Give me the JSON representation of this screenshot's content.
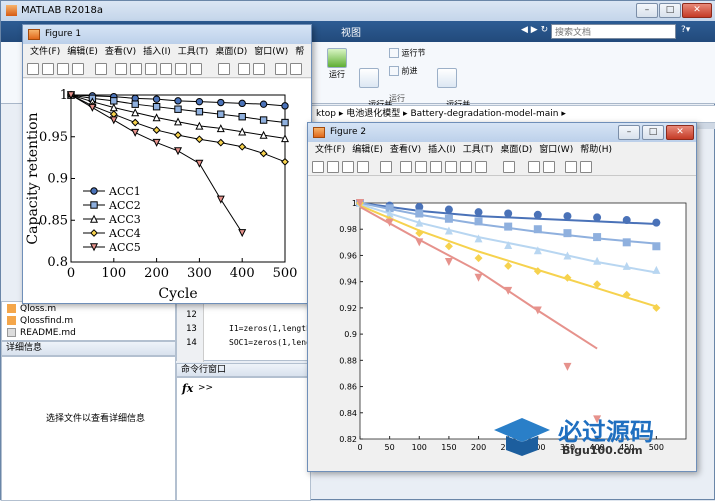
{
  "matlab": {
    "title": "MATLAB R2018a",
    "view_tab": "视图",
    "search_placeholder": "搜索文档",
    "run_section_title": "运行",
    "buttons": [
      {
        "label": "运行"
      },
      {
        "label": "运行并\n前进"
      },
      {
        "label": "运行节"
      },
      {
        "label": "前进"
      },
      {
        "label": "运行并\n计时"
      }
    ],
    "path": "ktop ▸ 电池退化模型 ▸ Battery-degradation-model-main ▸",
    "files": [
      "Qloss.m",
      "Qlossfind.m",
      "README.md"
    ],
    "details_header": "详细信息",
    "details_text": "选择文件以查看详细信息",
    "editor_lines": [
      {
        "num": "12",
        "code": ""
      },
      {
        "num": "13",
        "code": "I1=zeros(1,length"
      },
      {
        "num": "14",
        "code": "SOC1=zeros(1,leng"
      }
    ],
    "cmd_header": "命令行窗口",
    "cmd_prompt": ">>"
  },
  "figure1": {
    "title": "Figure 1",
    "menu": [
      "文件(F)",
      "编辑(E)",
      "查看(V)",
      "插入(I)",
      "工具(T)",
      "桌面(D)",
      "窗口(W)",
      "帮助(H)"
    ]
  },
  "figure2": {
    "title": "Figure 2",
    "menu": [
      "文件(F)",
      "编辑(E)",
      "查看(V)",
      "插入(I)",
      "工具(T)",
      "桌面(D)",
      "窗口(W)",
      "帮助(H)"
    ]
  },
  "watermark": {
    "text": "必过源码",
    "url": "Bigu100.com"
  },
  "chart_data": [
    {
      "type": "line",
      "xlabel": "Cycle",
      "ylabel": "Capacity retention",
      "xlim": [
        0,
        500
      ],
      "ylim": [
        0.8,
        1.0
      ],
      "xticks": [
        0,
        100,
        200,
        300,
        400,
        500
      ],
      "yticks": [
        0.8,
        0.85,
        0.9,
        0.95,
        1
      ],
      "ytick_labels": [
        "0.8",
        "0.85",
        "0.9",
        "0.95",
        "1"
      ],
      "grid": false,
      "legend_position": "bottom-left",
      "series": [
        {
          "name": "ACC1",
          "marker": "circle",
          "x": [
            0,
            50,
            100,
            150,
            200,
            250,
            300,
            350,
            400,
            450,
            500
          ],
          "y": [
            1.0,
            0.999,
            0.998,
            0.996,
            0.995,
            0.993,
            0.992,
            0.991,
            0.99,
            0.989,
            0.987
          ]
        },
        {
          "name": "ACC2",
          "marker": "square",
          "x": [
            0,
            50,
            100,
            150,
            200,
            250,
            300,
            350,
            400,
            450,
            500
          ],
          "y": [
            1.0,
            0.996,
            0.993,
            0.989,
            0.986,
            0.983,
            0.98,
            0.977,
            0.974,
            0.97,
            0.967
          ]
        },
        {
          "name": "ACC3",
          "marker": "triangle-up",
          "x": [
            0,
            50,
            100,
            150,
            200,
            250,
            300,
            350,
            400,
            450,
            500
          ],
          "y": [
            1.0,
            0.992,
            0.985,
            0.979,
            0.973,
            0.968,
            0.963,
            0.96,
            0.956,
            0.952,
            0.948
          ]
        },
        {
          "name": "ACC4",
          "marker": "diamond",
          "x": [
            0,
            50,
            100,
            150,
            200,
            250,
            300,
            350,
            400,
            450,
            500
          ],
          "y": [
            1.0,
            0.987,
            0.977,
            0.967,
            0.958,
            0.952,
            0.947,
            0.943,
            0.938,
            0.93,
            0.92
          ]
        },
        {
          "name": "ACC5",
          "marker": "triangle-down",
          "x": [
            0,
            50,
            100,
            150,
            200,
            250,
            300,
            350,
            400
          ],
          "y": [
            1.0,
            0.985,
            0.97,
            0.955,
            0.943,
            0.933,
            0.918,
            0.875,
            0.835
          ]
        }
      ]
    },
    {
      "type": "scatter",
      "xlim": [
        0,
        550
      ],
      "ylim": [
        0.82,
        1.0
      ],
      "xticks": [
        0,
        50,
        100,
        150,
        200,
        250,
        300,
        350,
        400,
        450,
        500
      ],
      "yticks": [
        0.82,
        0.84,
        0.86,
        0.88,
        0.9,
        0.92,
        0.94,
        0.96,
        0.98,
        1
      ],
      "ytick_labels": [
        "0.82",
        "0.84",
        "0.86",
        "0.88",
        "0.9",
        "0.92",
        "0.94",
        "0.96",
        "0.98",
        "1"
      ],
      "grid": false,
      "series": [
        {
          "marker": "circle",
          "color": "#4a72b8",
          "x": [
            0,
            50,
            100,
            150,
            200,
            250,
            300,
            350,
            400,
            450,
            500
          ],
          "y": [
            1.0,
            0.998,
            0.997,
            0.995,
            0.993,
            0.992,
            0.991,
            0.99,
            0.989,
            0.987,
            0.985
          ],
          "fit": {
            "x": [
              0,
              100,
              200,
              300,
              400,
              500
            ],
            "y": [
              1.0,
              0.994,
              0.99,
              0.988,
              0.986,
              0.984
            ]
          }
        },
        {
          "marker": "square",
          "color": "#8fb0de",
          "x": [
            0,
            50,
            100,
            150,
            200,
            250,
            300,
            350,
            400,
            450,
            500
          ],
          "y": [
            1.0,
            0.996,
            0.992,
            0.988,
            0.986,
            0.982,
            0.98,
            0.977,
            0.974,
            0.97,
            0.967
          ],
          "fit": {
            "x": [
              0,
              100,
              200,
              300,
              400,
              500
            ],
            "y": [
              1.0,
              0.991,
              0.984,
              0.978,
              0.973,
              0.969
            ]
          }
        },
        {
          "marker": "triangle-up",
          "color": "#b8d6f1",
          "x": [
            0,
            50,
            100,
            150,
            200,
            250,
            300,
            350,
            400,
            450,
            500
          ],
          "y": [
            1.0,
            0.992,
            0.985,
            0.979,
            0.973,
            0.968,
            0.964,
            0.96,
            0.956,
            0.952,
            0.949
          ],
          "fit": {
            "x": [
              0,
              100,
              200,
              300,
              400,
              500
            ],
            "y": [
              0.999,
              0.985,
              0.974,
              0.965,
              0.955,
              0.947
            ]
          }
        },
        {
          "marker": "diamond",
          "color": "#f6d24e",
          "x": [
            0,
            50,
            100,
            150,
            200,
            250,
            300,
            350,
            400,
            450,
            500
          ],
          "y": [
            1.0,
            0.987,
            0.977,
            0.967,
            0.958,
            0.952,
            0.948,
            0.943,
            0.938,
            0.93,
            0.92
          ],
          "fit": {
            "x": [
              0,
              100,
              200,
              300,
              400,
              500
            ],
            "y": [
              0.998,
              0.979,
              0.963,
              0.949,
              0.935,
              0.921
            ]
          }
        },
        {
          "marker": "triangle-down",
          "color": "#e6928c",
          "x": [
            0,
            50,
            100,
            150,
            200,
            250,
            300,
            350,
            400
          ],
          "y": [
            1.0,
            0.985,
            0.97,
            0.955,
            0.943,
            0.933,
            0.918,
            0.875,
            0.835
          ],
          "fit": {
            "x": [
              0,
              100,
              200,
              300,
              400
            ],
            "y": [
              0.997,
              0.972,
              0.948,
              0.918,
              0.889
            ]
          }
        }
      ]
    }
  ]
}
